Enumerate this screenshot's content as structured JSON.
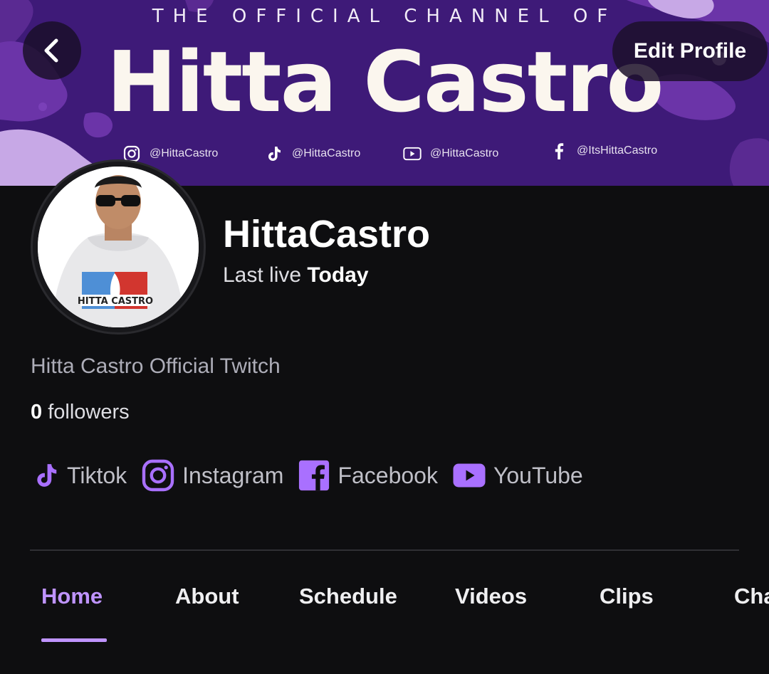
{
  "banner": {
    "tagline": "THE OFFICIAL CHANNEL OF",
    "title": "Hitta Castro",
    "socials": [
      {
        "icon": "instagram-icon",
        "handle": "@HittaCastro"
      },
      {
        "icon": "tiktok-icon",
        "handle": "@HittaCastro"
      },
      {
        "icon": "youtube-icon",
        "handle": "@HittaCastro"
      },
      {
        "icon": "facebook-icon",
        "handle": "@ItsHittaCastro"
      }
    ]
  },
  "header": {
    "back_icon": "chevron-left-icon",
    "edit_label": "Edit Profile"
  },
  "profile": {
    "name": "HittaCastro",
    "last_live_prefix": "Last live",
    "last_live_value": "Today",
    "bio": "Hitta Castro Official Twitch",
    "followers_count": "0",
    "followers_label": "followers",
    "avatar_shirt_text": "HITTA CASTRO"
  },
  "links": [
    {
      "icon": "tiktok-icon",
      "label": "Tiktok"
    },
    {
      "icon": "instagram-icon",
      "label": "Instagram"
    },
    {
      "icon": "facebook-icon",
      "label": "Facebook"
    },
    {
      "icon": "youtube-icon",
      "label": "YouTube"
    }
  ],
  "tabs": [
    {
      "label": "Home",
      "active": true
    },
    {
      "label": "About"
    },
    {
      "label": "Schedule"
    },
    {
      "label": "Videos"
    },
    {
      "label": "Clips"
    },
    {
      "label": "Cha"
    }
  ],
  "colors": {
    "background": "#0e0e10",
    "accent": "#bf94ff",
    "icon_purple": "#a970ff",
    "banner": "#3e1a78"
  }
}
